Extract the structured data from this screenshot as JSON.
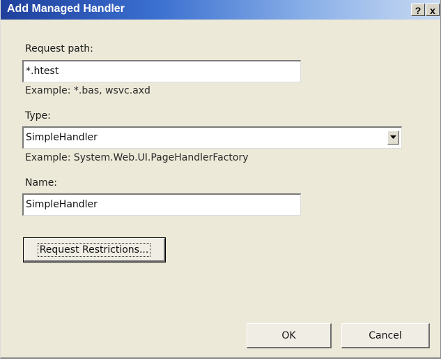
{
  "window": {
    "title": "Add Managed Handler",
    "help_glyph": "?",
    "close_glyph": "x"
  },
  "form": {
    "request_path": {
      "label": "Request path:",
      "value": "*.htest",
      "example": "Example: *.bas, wsvc.axd"
    },
    "type": {
      "label": "Type:",
      "value": "SimpleHandler",
      "example": "Example: System.Web.UI.PageHandlerFactory"
    },
    "name": {
      "label": "Name:",
      "value": "SimpleHandler"
    }
  },
  "buttons": {
    "request_restrictions": "Request Restrictions...",
    "ok": "OK",
    "cancel": "Cancel"
  },
  "colors": {
    "titlebar_start": "#1f3f9c",
    "dialog_bg": "#ece9d8"
  },
  "icons": {
    "help": "help-icon",
    "close": "close-icon",
    "dropdown": "chevron-down-icon"
  }
}
